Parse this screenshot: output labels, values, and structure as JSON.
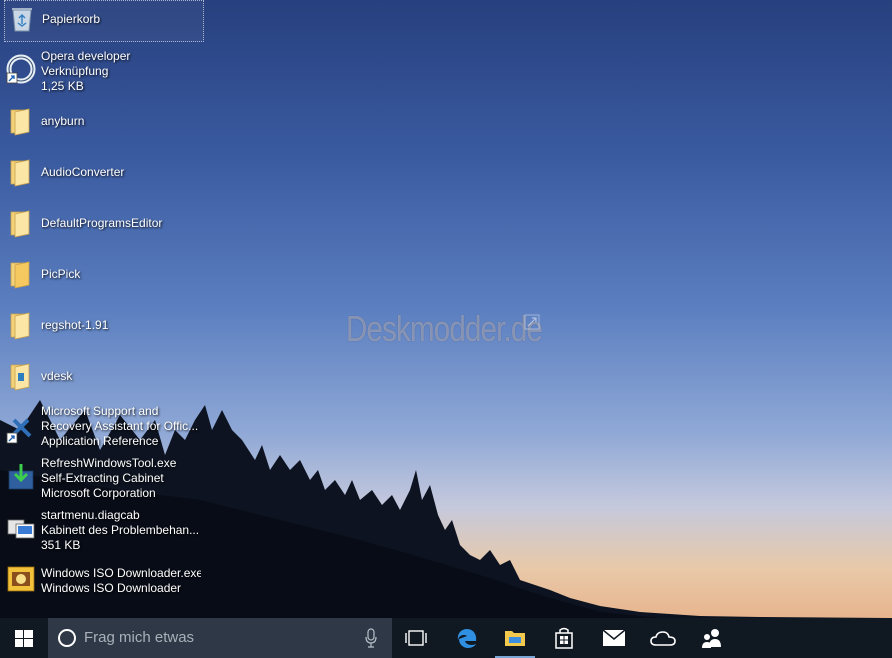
{
  "desktop": {
    "watermark": "Deskmodder.de",
    "icons": [
      {
        "name": "recycle-bin",
        "lines": [
          "Papierkorb"
        ],
        "icon": "recycle-bin-icon",
        "selected": true
      },
      {
        "name": "opera-developer",
        "lines": [
          "Opera developer",
          "Verknüpfung",
          "1,25 KB"
        ],
        "icon": "opera-shortcut-icon"
      },
      {
        "name": "anyburn",
        "lines": [
          "anyburn"
        ],
        "icon": "folder-icon"
      },
      {
        "name": "audioconverter",
        "lines": [
          "AudioConverter"
        ],
        "icon": "folder-icon"
      },
      {
        "name": "defaultprogramseditor",
        "lines": [
          "DefaultProgramsEditor"
        ],
        "icon": "folder-icon"
      },
      {
        "name": "picpick",
        "lines": [
          "PicPick"
        ],
        "icon": "folder-icon"
      },
      {
        "name": "regshot",
        "lines": [
          "regshot-1.91"
        ],
        "icon": "folder-icon"
      },
      {
        "name": "vdesk",
        "lines": [
          "vdesk"
        ],
        "icon": "folder-icon"
      },
      {
        "name": "microsoft-support",
        "lines": [
          "Microsoft Support and",
          "Recovery Assistant for Offic...",
          "Application Reference"
        ],
        "icon": "tools-shortcut-icon"
      },
      {
        "name": "refreshwindowstool",
        "lines": [
          "RefreshWindowsTool.exe",
          "Self-Extracting Cabinet",
          "Microsoft Corporation"
        ],
        "icon": "refresh-tool-icon"
      },
      {
        "name": "startmenu-diagcab",
        "lines": [
          "startmenu.diagcab",
          "Kabinett des Problembehan...",
          "351 KB"
        ],
        "icon": "diagcab-icon"
      },
      {
        "name": "windows-iso-downloader",
        "lines": [
          "Windows ISO Downloader.exe",
          "Windows ISO Downloader"
        ],
        "icon": "iso-downloader-icon"
      }
    ]
  },
  "taskbar": {
    "search_placeholder": "Frag mich etwas",
    "buttons": [
      "start-icon",
      "task-view-icon",
      "edge-icon",
      "file-explorer-icon",
      "store-icon",
      "mail-icon",
      "onedrive-icon",
      "people-icon"
    ]
  },
  "colors": {
    "taskbar": "#101822",
    "search": "#2e3846",
    "accent": "#7aa7d6"
  }
}
